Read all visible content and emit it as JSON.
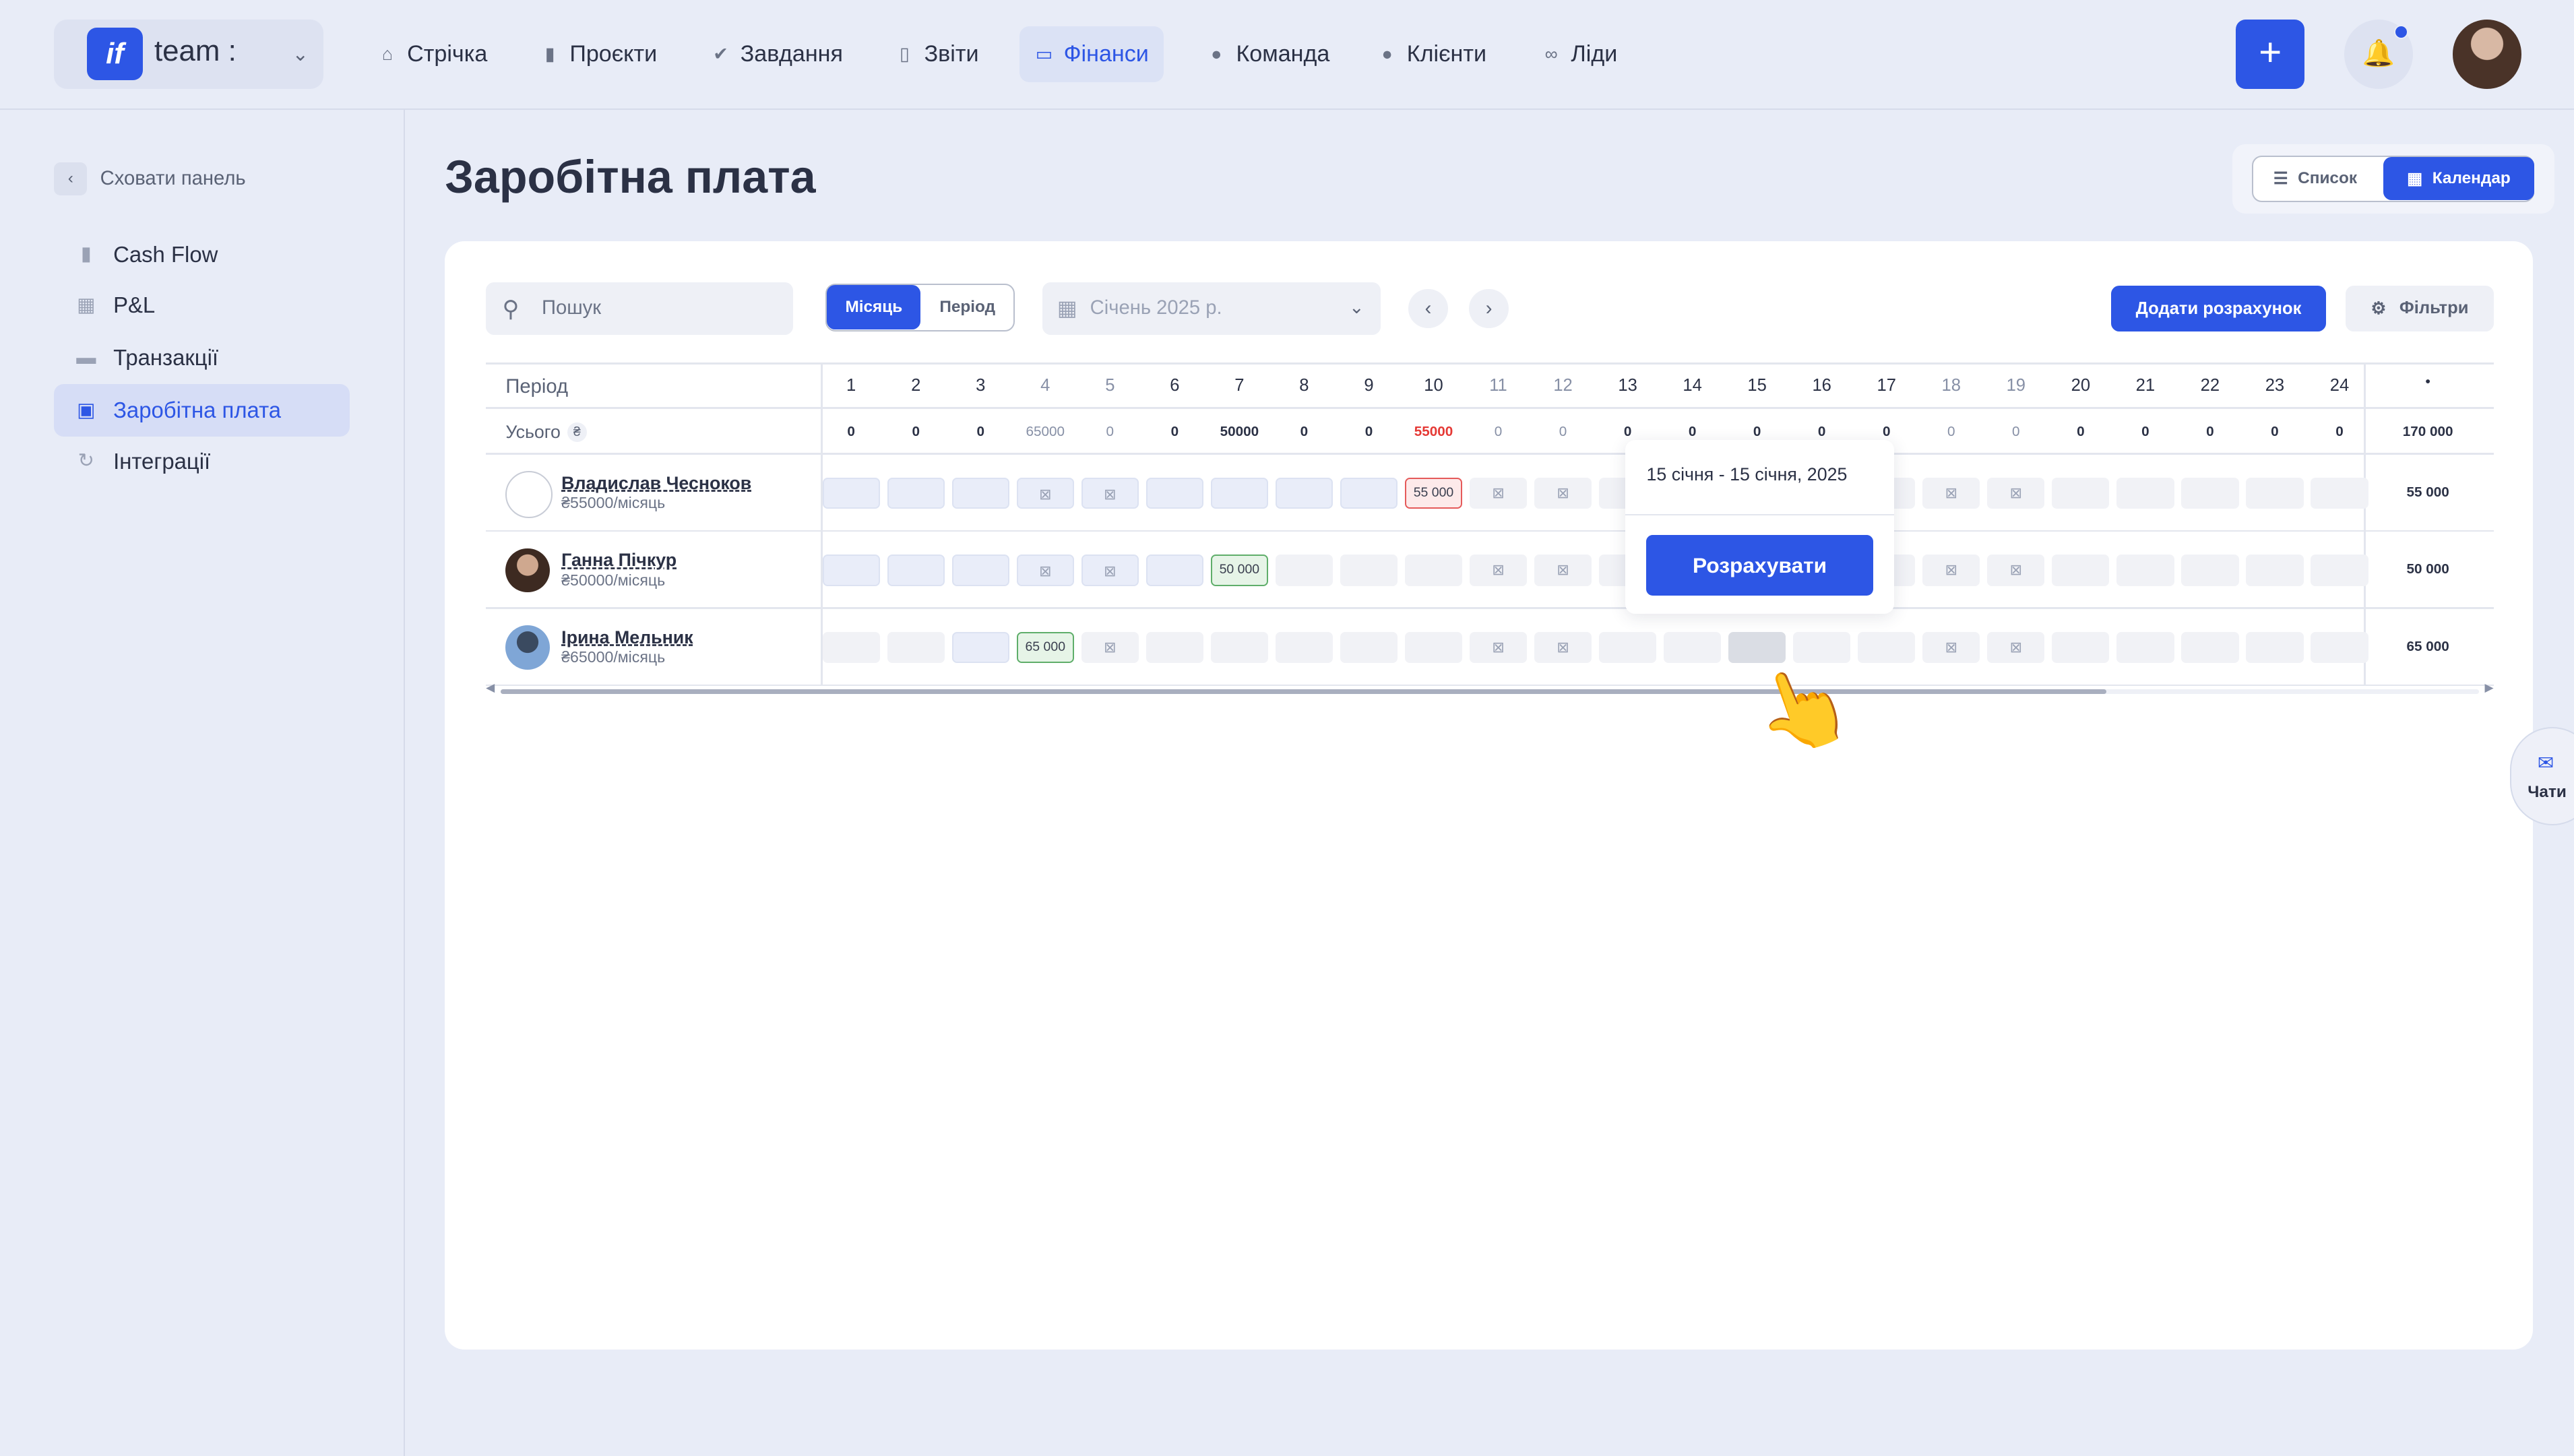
{
  "app": {
    "name": "team :",
    "logo": "if"
  },
  "nav": [
    {
      "label": "Стрічка",
      "icon": "home-icon"
    },
    {
      "label": "Проєкти",
      "icon": "file-icon"
    },
    {
      "label": "Завдання",
      "icon": "check-circle-icon"
    },
    {
      "label": "Звіти",
      "icon": "report-icon"
    },
    {
      "label": "Фінанси",
      "icon": "wallet-icon",
      "active": true
    },
    {
      "label": "Команда",
      "icon": "user-icon"
    },
    {
      "label": "Клієнти",
      "icon": "users-icon"
    },
    {
      "label": "Ліди",
      "icon": "link-icon"
    }
  ],
  "sidebar": {
    "hide_label": "Сховати панель",
    "items": [
      {
        "label": "Cash Flow",
        "icon": "chart-icon"
      },
      {
        "label": "P&L",
        "icon": "calendar-icon"
      },
      {
        "label": "Транзакції",
        "icon": "list-icon"
      },
      {
        "label": "Заробітна плата",
        "icon": "briefcase-icon",
        "active": true
      },
      {
        "label": "Інтеграції",
        "icon": "refresh-icon"
      }
    ]
  },
  "page": {
    "title": "Заробітна плата",
    "view_list": "Список",
    "view_calendar": "Календар",
    "search_placeholder": "Пошук",
    "seg_month": "Місяць",
    "seg_period": "Період",
    "month": "Січень 2025 р.",
    "add_button": "Додати розрахунок",
    "filters": "Фільтри"
  },
  "table": {
    "period_label": "Період",
    "total_label": "Усього",
    "currency": "₴",
    "days": [
      "1",
      "2",
      "3",
      "4",
      "5",
      "6",
      "7",
      "8",
      "9",
      "10",
      "11",
      "12",
      "13",
      "14",
      "15",
      "16",
      "17",
      "18",
      "19",
      "20",
      "21",
      "22",
      "23",
      "24"
    ],
    "total_col_label": "•",
    "totals": [
      "0",
      "0",
      "0",
      "65000",
      "0",
      "0",
      "50000",
      "0",
      "0",
      "55000",
      "0",
      "0",
      "0",
      "0",
      "0",
      "0",
      "0",
      "0",
      "0",
      "0",
      "0",
      "0",
      "0",
      "0"
    ],
    "grand_total": "170 000",
    "employees": [
      {
        "name": "Владислав Чесноков",
        "salary": "₴55000/місяць",
        "total": "55 000",
        "pay_day": 10,
        "pay_amount": "55 000",
        "pay_color": "red"
      },
      {
        "name": "Ганна Пічкур",
        "salary": "₴50000/місяць",
        "total": "50 000",
        "pay_day": 7,
        "pay_amount": "50 000",
        "pay_color": "green"
      },
      {
        "name": "Ірина Мельник",
        "salary": "₴65000/місяць",
        "total": "65 000",
        "pay_day": 4,
        "pay_amount": "65 000",
        "pay_color": "green"
      }
    ]
  },
  "popover": {
    "date": "15 січня - 15 січня, 2025",
    "button": "Розрахувати"
  },
  "chats": {
    "label": "Чати"
  },
  "colors": {
    "accent": "#2d56e5",
    "negative": "#e53935",
    "positive": "#5fae6a"
  }
}
